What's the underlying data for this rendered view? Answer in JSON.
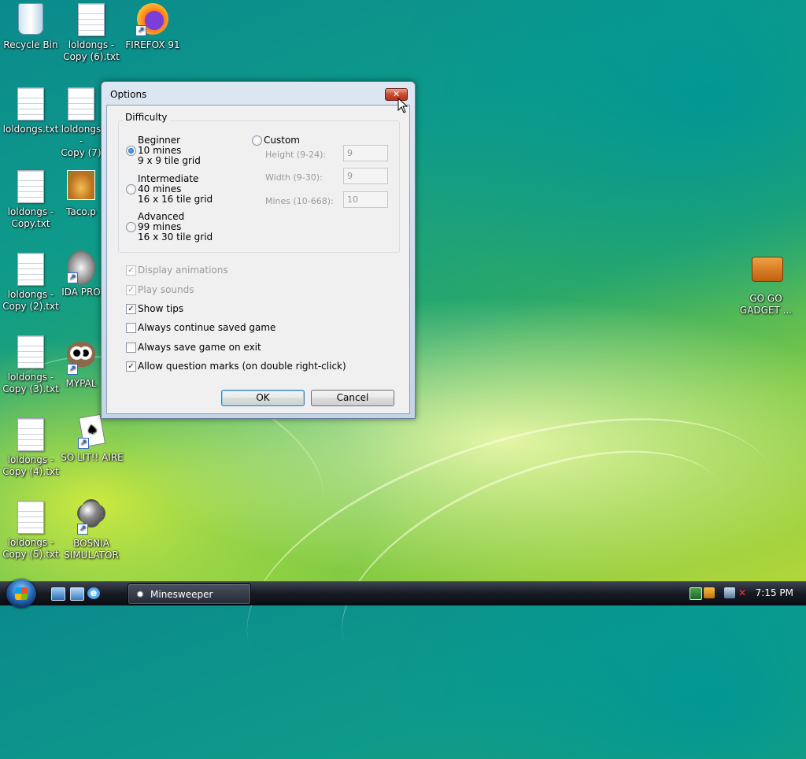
{
  "desktop": {
    "icons": [
      {
        "label": "Recycle Bin"
      },
      {
        "label": "loldongs -\nCopy (6).txt"
      },
      {
        "label": "FIREFOX 91"
      },
      {
        "label": "loldongs.txt"
      },
      {
        "label": "loldongs -\nCopy (7)"
      },
      {
        "label": "loldongs -\nCopy.txt"
      },
      {
        "label": "Taco.p"
      },
      {
        "label": "loldongs -\nCopy (2).txt"
      },
      {
        "label": "IDA PRO"
      },
      {
        "label": "loldongs -\nCopy (3).txt"
      },
      {
        "label": "MYPAL"
      },
      {
        "label": "loldongs -\nCopy (4).txt"
      },
      {
        "label": "SO LIT!! AIRE"
      },
      {
        "label": "loldongs -\nCopy (5).txt"
      },
      {
        "label": "BOSNIA\nSIMULATOR"
      },
      {
        "label": "GO GO\nGADGET ..."
      }
    ]
  },
  "dialog": {
    "title": "Options",
    "close_glyph": "✕",
    "difficulty_label": "Difficulty",
    "beginner": {
      "l1": "Beginner",
      "l2": "10 mines",
      "l3": "9 x 9 tile grid",
      "selected": true
    },
    "intermediate": {
      "l1": "Intermediate",
      "l2": "40 mines",
      "l3": "16 x 16 tile grid",
      "selected": false
    },
    "advanced": {
      "l1": "Advanced",
      "l2": "99 mines",
      "l3": "16 x 30 tile grid",
      "selected": false
    },
    "custom": {
      "label": "Custom",
      "height_label": "Height (9-24):",
      "height_value": "9",
      "width_label": "Width (9-30):",
      "width_value": "9",
      "mines_label": "Mines (10-668):",
      "mines_value": "10"
    },
    "options": [
      {
        "label": "Display animations",
        "checked": true,
        "disabled": true
      },
      {
        "label": "Play sounds",
        "checked": true,
        "disabled": true
      },
      {
        "label": "Show tips",
        "checked": true,
        "disabled": false
      },
      {
        "label": "Always continue saved game",
        "checked": false,
        "disabled": false
      },
      {
        "label": "Always save game on exit",
        "checked": false,
        "disabled": false
      },
      {
        "label": "Allow question marks (on double right-click)",
        "checked": true,
        "disabled": false
      }
    ],
    "ok_label": "OK",
    "cancel_label": "Cancel"
  },
  "taskbar": {
    "task_label": "Minesweeper",
    "clock": "7:15 PM"
  }
}
